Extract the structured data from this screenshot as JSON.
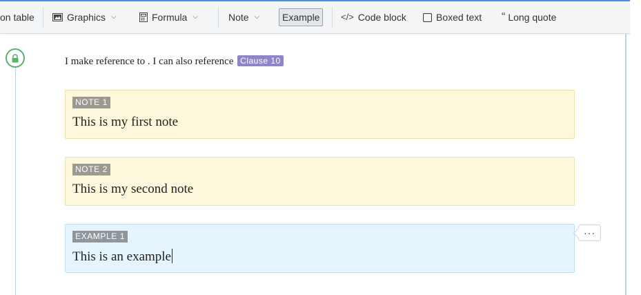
{
  "toolbar": {
    "items": [
      {
        "label": "on table"
      },
      {
        "label": "Graphics",
        "icon": "image-icon"
      },
      {
        "label": "Formula",
        "icon": "calculator-icon"
      },
      {
        "label": "Note"
      },
      {
        "label": "Example"
      },
      {
        "label": "Code block",
        "icon": "code-icon"
      },
      {
        "label": "Boxed text",
        "icon": "box-icon"
      },
      {
        "label": "Long quote",
        "icon": "quote-icon"
      }
    ],
    "active": "Example",
    "accent": "#4a90e2"
  },
  "content": {
    "paragraph": "I make reference to . I can also reference",
    "clause_ref": "Clause 10",
    "notes": [
      {
        "label": "NOTE 1",
        "text": "This is my first note"
      },
      {
        "label": "NOTE 2",
        "text": "This is my second note"
      }
    ],
    "example": {
      "label": "EXAMPLE 1",
      "text": "This is an example"
    },
    "more_label": "···"
  },
  "colors": {
    "note_bg": "#fdf8dc",
    "example_bg": "#e6f4fd",
    "clause_tag": "#8e86c9",
    "lock_green": "#58b368"
  }
}
